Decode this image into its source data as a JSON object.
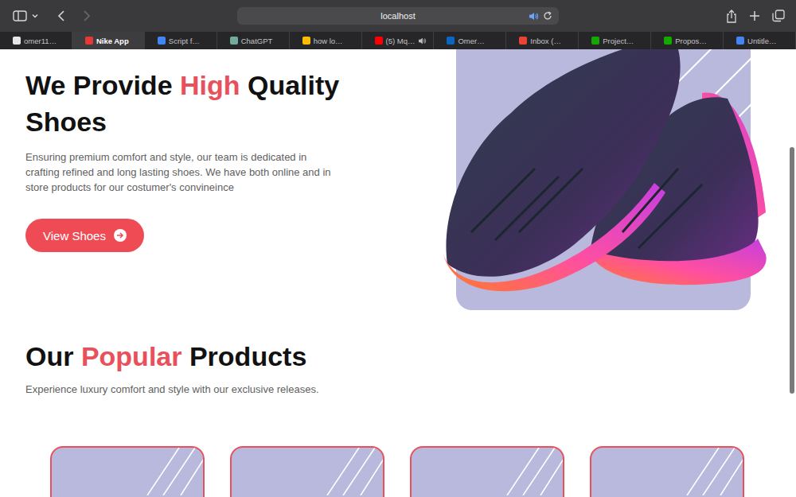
{
  "browser": {
    "address": "localhost",
    "audio_playing": true
  },
  "tabs": [
    {
      "label": "omer11…",
      "selected": false,
      "audio": false,
      "color": "#e6e6e6"
    },
    {
      "label": "Nike App",
      "selected": true,
      "audio": false,
      "color": "#e53935"
    },
    {
      "label": "Script f…",
      "selected": false,
      "audio": false,
      "color": "#4285f4"
    },
    {
      "label": "ChatGPT",
      "selected": false,
      "audio": false,
      "color": "#74aa9c"
    },
    {
      "label": "how lo…",
      "selected": false,
      "audio": false,
      "color": "#fbbc05"
    },
    {
      "label": "(5) Mq…",
      "selected": false,
      "audio": true,
      "color": "#ff0000"
    },
    {
      "label": "Omer…",
      "selected": false,
      "audio": false,
      "color": "#0a66c2"
    },
    {
      "label": "Inbox (…",
      "selected": false,
      "audio": false,
      "color": "#ea4335"
    },
    {
      "label": "Project…",
      "selected": false,
      "audio": false,
      "color": "#14a800"
    },
    {
      "label": "Propos…",
      "selected": false,
      "audio": false,
      "color": "#14a800"
    },
    {
      "label": "Untitle…",
      "selected": false,
      "audio": false,
      "color": "#4285f4"
    }
  ],
  "hero": {
    "title_start": "We Provide ",
    "title_highlight": "High",
    "title_end": " Quality Shoes",
    "description": "Ensuring premium comfort and style, our team is dedicated in crafting refined and long lasting shoes. We have both online and in store products for our costumer's convineince",
    "button": "View Shoes"
  },
  "popular": {
    "title_start": "Our ",
    "title_highlight": "Popular",
    "title_end": " Products",
    "subtitle": "Experience luxury comfort and style with our exclusive releases."
  },
  "products": [
    {},
    {},
    {},
    {}
  ]
}
